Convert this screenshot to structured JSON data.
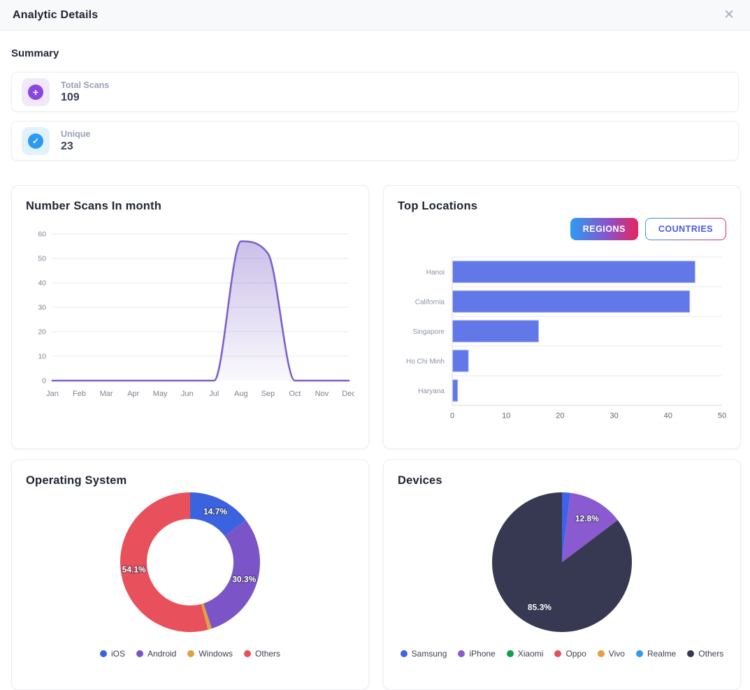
{
  "header": {
    "title": "Analytic Details",
    "close_icon": "✕"
  },
  "summary": {
    "heading": "Summary",
    "cards": [
      {
        "icon": "plus-circle-icon",
        "glyph": "+",
        "label": "Total Scans",
        "value": "109",
        "accent": "#8a47e0",
        "icon_bg": "#f1e9fb"
      },
      {
        "icon": "check-circle-icon",
        "glyph": "✓",
        "label": "Unique",
        "value": "23",
        "accent": "#2b9af3",
        "icon_bg": "#e2f2fd"
      }
    ]
  },
  "chart_data": [
    {
      "type": "area",
      "title": "Number Scans In month",
      "x": [
        "Jan",
        "Feb",
        "Mar",
        "Apr",
        "May",
        "Jun",
        "Jul",
        "Aug",
        "Sep",
        "Oct",
        "Nov",
        "Dec"
      ],
      "values": [
        0,
        0,
        0,
        0,
        0,
        0,
        0,
        57,
        52,
        0,
        0,
        0
      ],
      "ylim": [
        0,
        60
      ],
      "yticks": [
        0,
        10,
        20,
        30,
        40,
        50,
        60
      ],
      "grid": true,
      "line_color": "#7d60c9",
      "fill_from": "rgba(125,96,201,0.40)",
      "fill_to": "rgba(125,96,201,0.04)"
    },
    {
      "type": "bar",
      "orientation": "horizontal",
      "title": "Top Locations",
      "toggle": [
        "REGIONS",
        "COUNTRIES"
      ],
      "active_toggle": "REGIONS",
      "categories": [
        "Hanoi",
        "California",
        "Singapore",
        "Ho Chi Minh",
        "Haryana"
      ],
      "values": [
        45,
        44,
        16,
        3,
        1
      ],
      "xlim": [
        0,
        50
      ],
      "xticks": [
        0,
        10,
        20,
        30,
        40,
        50
      ],
      "bar_color": "#6277e8",
      "bar_border": "#aeb8f0"
    },
    {
      "type": "donut",
      "title": "Operating System",
      "labels": [
        "iOS",
        "Android",
        "Windows",
        "Others"
      ],
      "values": [
        14.7,
        30.3,
        0.9,
        54.1
      ],
      "colors": [
        "#3b63e0",
        "#7b55c8",
        "#e0a23e",
        "#e8505b"
      ],
      "slice_labels": [
        "14.7%",
        "30.3%",
        "",
        "54.1%"
      ],
      "legend_position": "bottom"
    },
    {
      "type": "pie",
      "title": "Devices",
      "labels": [
        "Samsung",
        "iPhone",
        "Xiaomi",
        "Oppo",
        "Vivo",
        "Realme",
        "Others"
      ],
      "values": [
        1.9,
        12.8,
        0,
        0,
        0,
        0,
        85.3
      ],
      "colors": [
        "#3e63e8",
        "#8a5bd0",
        "#0da14e",
        "#e8505b",
        "#e0a23e",
        "#2e9bf0",
        "#373952"
      ],
      "slice_labels": [
        "",
        "12.8%",
        "",
        "",
        "",
        "",
        "85.3%"
      ],
      "legend_position": "bottom"
    }
  ]
}
